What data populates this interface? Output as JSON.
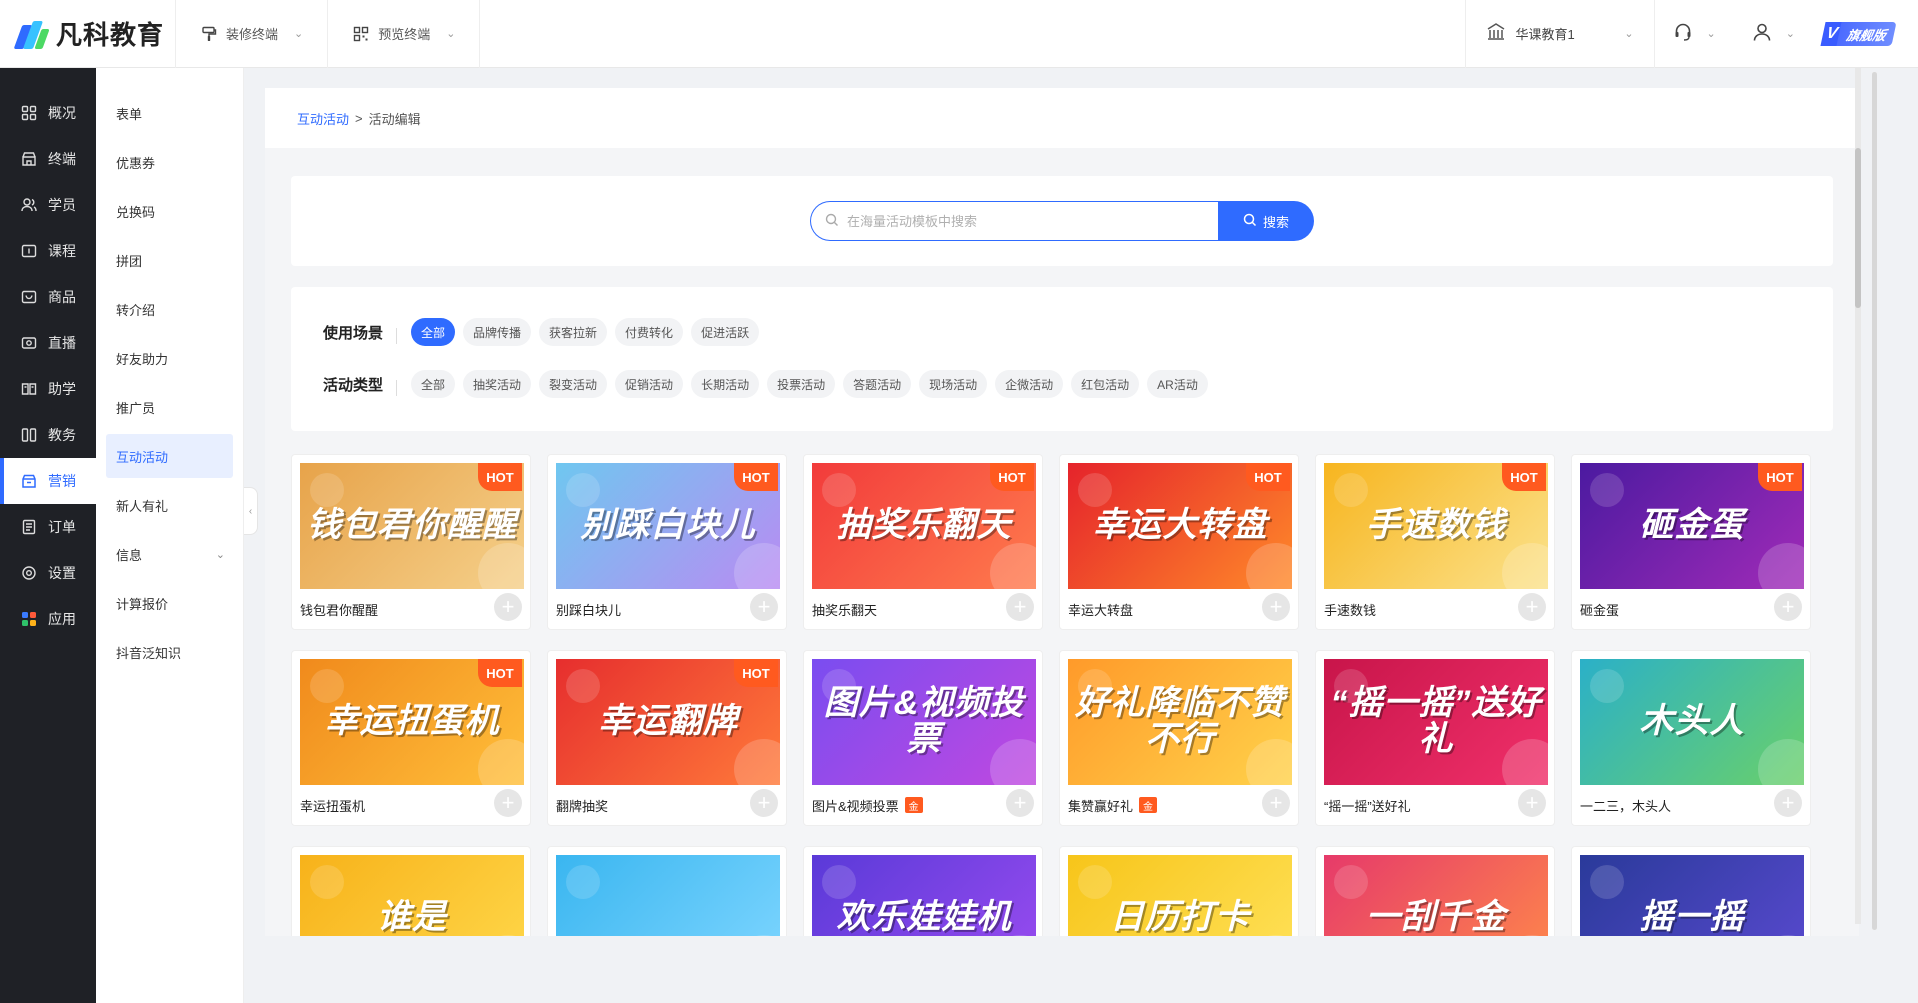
{
  "brand": {
    "name": "凡科教育"
  },
  "topnav": [
    {
      "label": "装修终端",
      "icon": "paint-roller-icon"
    },
    {
      "label": "预览终端",
      "icon": "qr-code-icon"
    }
  ],
  "org": {
    "name": "华课教育1"
  },
  "vip": {
    "label": "旗舰版",
    "mark": "V"
  },
  "leftnav": [
    {
      "label": "概况",
      "icon": "grid-icon",
      "active": false
    },
    {
      "label": "终端",
      "icon": "store-icon",
      "active": false
    },
    {
      "label": "学员",
      "icon": "users-icon",
      "active": false
    },
    {
      "label": "课程",
      "icon": "course-icon",
      "active": false
    },
    {
      "label": "商品",
      "icon": "product-icon",
      "active": false
    },
    {
      "label": "直播",
      "icon": "live-icon",
      "active": false
    },
    {
      "label": "助学",
      "icon": "book-icon",
      "active": false
    },
    {
      "label": "教务",
      "icon": "columns-icon",
      "active": false
    },
    {
      "label": "营销",
      "icon": "marketing-icon",
      "active": true
    },
    {
      "label": "订单",
      "icon": "order-icon",
      "active": false
    },
    {
      "label": "设置",
      "icon": "gear-icon",
      "active": false
    },
    {
      "label": "应用",
      "icon": "apps-icon",
      "active": false
    }
  ],
  "subnav": [
    {
      "label": "表单",
      "active": false
    },
    {
      "label": "优惠券",
      "active": false
    },
    {
      "label": "兑换码",
      "active": false
    },
    {
      "label": "拼团",
      "active": false
    },
    {
      "label": "转介绍",
      "active": false
    },
    {
      "label": "好友助力",
      "active": false
    },
    {
      "label": "推广员",
      "active": false
    },
    {
      "label": "互动活动",
      "active": true
    },
    {
      "label": "新人有礼",
      "active": false
    },
    {
      "label": "信息",
      "active": false,
      "expandable": true
    },
    {
      "label": "计算报价",
      "active": false
    },
    {
      "label": "抖音泛知识",
      "active": false
    }
  ],
  "breadcrumb": {
    "parent": "互动活动",
    "sep": ">",
    "current": "活动编辑"
  },
  "search": {
    "placeholder": "在海量活动模板中搜索",
    "button": "搜索"
  },
  "filters": {
    "scene": {
      "label": "使用场景",
      "options": [
        "全部",
        "品牌传播",
        "获客拉新",
        "付费转化",
        "促进活跃"
      ],
      "active": 0
    },
    "type": {
      "label": "活动类型",
      "options": [
        "全部",
        "抽奖活动",
        "裂变活动",
        "促销活动",
        "长期活动",
        "投票活动",
        "答题活动",
        "现场活动",
        "企微活动",
        "红包活动",
        "AR活动"
      ],
      "active": -1
    }
  },
  "templates": [
    {
      "name": "钱包君你醒醒",
      "thumb_text": "钱包君你醒醒",
      "hot": "HOT",
      "badge": "",
      "bg1": "#e7a34a",
      "bg2": "#f5d08a"
    },
    {
      "name": "别踩白块儿",
      "thumb_text": "别踩白块儿",
      "hot": "HOT",
      "badge": "",
      "bg1": "#6fc7f0",
      "bg2": "#b98bf2"
    },
    {
      "name": "抽奖乐翻天",
      "thumb_text": "抽奖乐翻天",
      "hot": "HOT",
      "badge": "",
      "bg1": "#f23b3b",
      "bg2": "#ff7b4d"
    },
    {
      "name": "幸运大转盘",
      "thumb_text": "幸运大转盘",
      "hot": "HOT",
      "badge": "",
      "bg1": "#e5232b",
      "bg2": "#ff8a2a"
    },
    {
      "name": "手速数钱",
      "thumb_text": "手速数钱",
      "hot": "HOT",
      "badge": "",
      "bg1": "#f7b51f",
      "bg2": "#fbe28c"
    },
    {
      "name": "砸金蛋",
      "thumb_text": "砸金蛋",
      "hot": "HOT",
      "badge": "",
      "bg1": "#4b1aa0",
      "bg2": "#a12bb8"
    },
    {
      "name": "幸运扭蛋机",
      "thumb_text": "幸运扭蛋机",
      "hot": "HOT",
      "badge": "",
      "bg1": "#f08a1c",
      "bg2": "#ffbf3a"
    },
    {
      "name": "翻牌抽奖",
      "thumb_text": "幸运翻牌",
      "hot": "HOT",
      "badge": "",
      "bg1": "#e62e2e",
      "bg2": "#ff7a3a"
    },
    {
      "name": "图片&视频投票",
      "thumb_text": "图片&视频投票",
      "hot": "",
      "badge": "金",
      "bg1": "#7a4df0",
      "bg2": "#c048e0"
    },
    {
      "name": "集赞赢好礼",
      "thumb_text": "好礼降临不赞不行",
      "hot": "",
      "badge": "金",
      "bg1": "#ff9a2a",
      "bg2": "#ffd24a"
    },
    {
      "name": "“摇一摇”送好礼",
      "thumb_text": "“摇一摇”送好礼",
      "hot": "",
      "badge": "",
      "bg1": "#c8154a",
      "bg2": "#f0306a"
    },
    {
      "name": "一二三，木头人",
      "thumb_text": "木头人",
      "hot": "",
      "badge": "",
      "bg1": "#2bb0c8",
      "bg2": "#6ad06a"
    },
    {
      "name": "",
      "thumb_text": "谁是",
      "hot": "",
      "badge": "",
      "bg1": "#f7b21a",
      "bg2": "#ffd84a"
    },
    {
      "name": "",
      "thumb_text": "",
      "hot": "",
      "badge": "",
      "bg1": "#3ab6f0",
      "bg2": "#7fd6ff"
    },
    {
      "name": "",
      "thumb_text": "欢乐娃娃机",
      "hot": "",
      "badge": "",
      "bg1": "#5a3ad8",
      "bg2": "#9a4cf0"
    },
    {
      "name": "",
      "thumb_text": "日历打卡",
      "hot": "",
      "badge": "",
      "bg1": "#f7c51a",
      "bg2": "#ffe25a"
    },
    {
      "name": "",
      "thumb_text": "一刮千金",
      "hot": "",
      "badge": "",
      "bg1": "#e63a6a",
      "bg2": "#ff8a4a"
    },
    {
      "name": "",
      "thumb_text": "摇一摇",
      "hot": "",
      "badge": "",
      "bg1": "#2a3a9a",
      "bg2": "#5a4ad0"
    }
  ]
}
